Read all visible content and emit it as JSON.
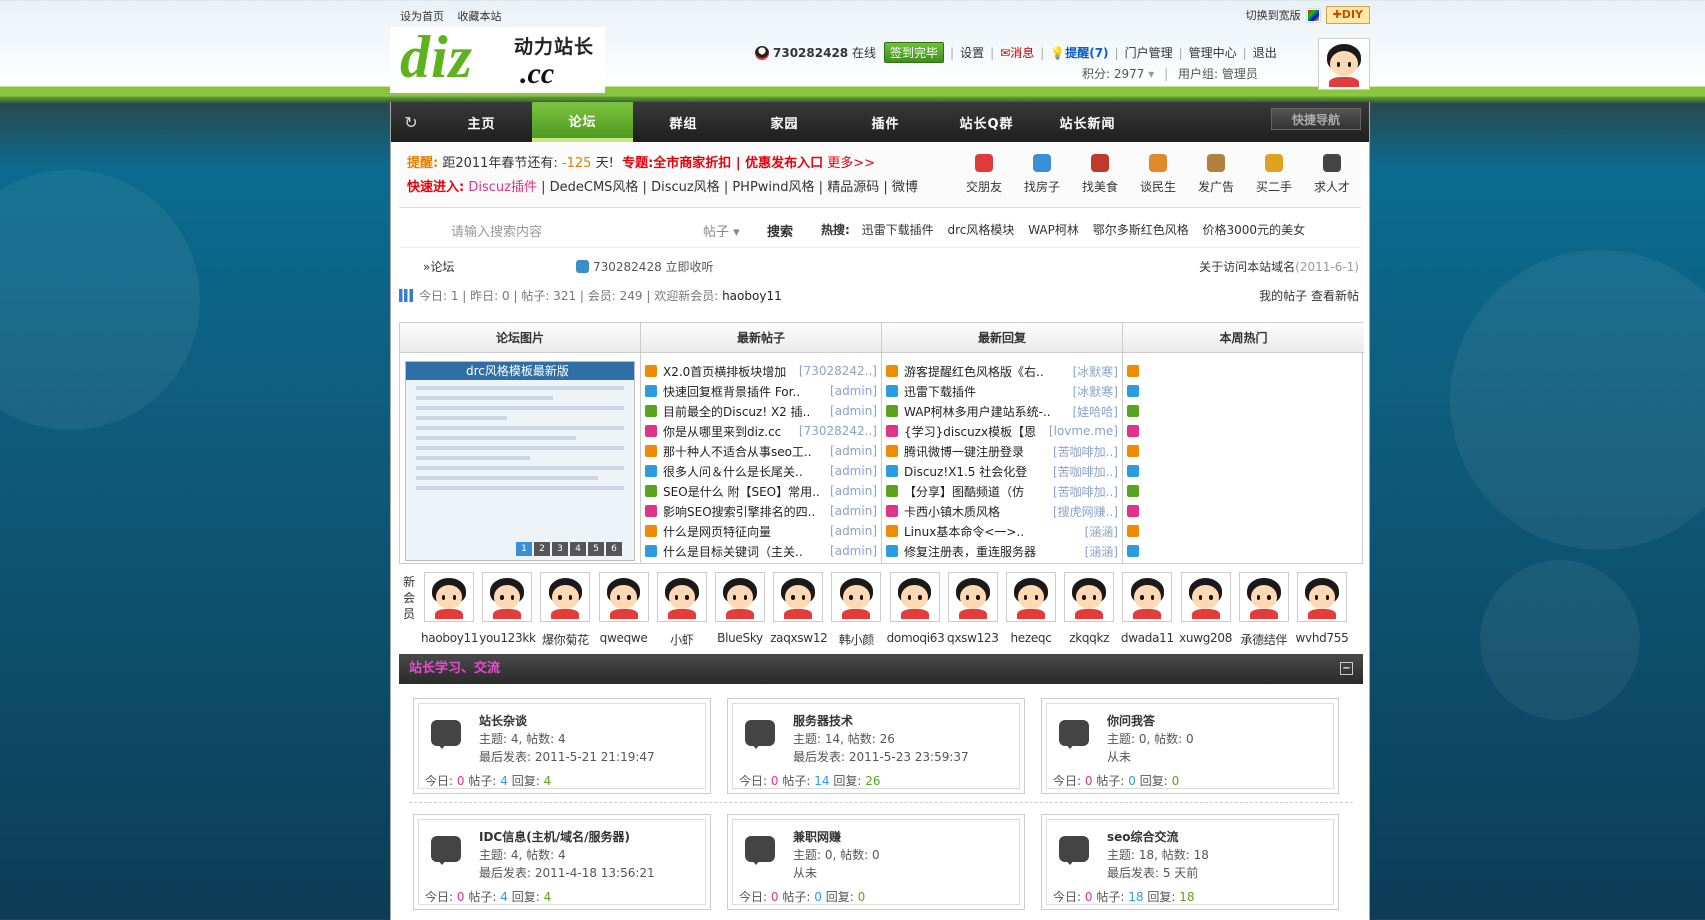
{
  "topbar": {
    "set_home": "设为首页",
    "favorite": "收藏本站",
    "switch_wide": "切换到宽版",
    "diy": "✚DIY"
  },
  "logo": {
    "brand_cn": "动力站长",
    "brand": "diz",
    "tld": ".cc"
  },
  "user": {
    "qq": "730282428",
    "online": "在线",
    "sign": "签到完毕",
    "settings": "设置",
    "messages": "消息",
    "reminders": "提醒(7)",
    "portal_admin": "门户管理",
    "admin_center": "管理中心",
    "logout": "退出",
    "points": "积分: 2977",
    "group": "用户组: 管理员"
  },
  "nav": {
    "items": [
      "主页",
      "论坛",
      "群组",
      "家园",
      "插件",
      "站长Q群",
      "站长新闻"
    ],
    "active": 1,
    "quick": "快捷导航"
  },
  "notice": {
    "label": "提醒:",
    "countdown_pre": "距2011年春节还有:",
    "countdown_val": "-125",
    "countdown_unit": "天!",
    "promo": "专题:全市商家折扣 | 优惠发布入口",
    "more": "更多>>",
    "quick_label": "快速进入:",
    "quick_links": [
      "Discuz插件",
      "DedeCMS风格",
      "Discuz风格",
      "PHPwind风格",
      "精品源码",
      "微博"
    ]
  },
  "categories": [
    {
      "label": "交朋友",
      "color": "#e03a3a"
    },
    {
      "label": "找房子",
      "color": "#3a8fd8"
    },
    {
      "label": "找美食",
      "color": "#c0392b"
    },
    {
      "label": "谈民生",
      "color": "#e08a2a"
    },
    {
      "label": "发广告",
      "color": "#b08040"
    },
    {
      "label": "买二手",
      "color": "#e0a020"
    },
    {
      "label": "求人才",
      "color": "#444444"
    }
  ],
  "search": {
    "placeholder": "请输入搜索内容",
    "select": "帖子 ▾",
    "button": "搜索",
    "hot_label": "热搜:",
    "hot": [
      "迅雷下载插件",
      "drc风格模块",
      "WAP柯林",
      "鄂尔多斯红色风格",
      "价格3000元的美女"
    ]
  },
  "crumb": {
    "home": "»论坛",
    "qq_text": "730282428 立即收听",
    "notice_title": "关于访问本站域名",
    "notice_date": "(2011-6-1)"
  },
  "stats": {
    "text": "今日: 1 | 昨日: 0 | 帖子: 321 | 会员: 249 | 欢迎新会员:",
    "newest": "haoboy11",
    "my_posts": "我的帖子",
    "new_posts": "查看新帖"
  },
  "panels": {
    "pics": "论坛图片",
    "latest": "最新帖子",
    "replies": "最新回复",
    "hot": "本周热门",
    "pic_caption": "drc风格模板最新版"
  },
  "latest_posts": [
    {
      "t": "X2.0首页横排板块增加",
      "u": "[73028242..]"
    },
    {
      "t": "快速回复框背景插件 For..",
      "u": "[admin]"
    },
    {
      "t": "目前最全的Discuz! X2 插..",
      "u": "[admin]"
    },
    {
      "t": "你是从哪里来到diz.cc",
      "u": "[73028242..]"
    },
    {
      "t": "那十种人不适合从事seo工..",
      "u": "[admin]"
    },
    {
      "t": "很多人问＆什么是长尾关..",
      "u": "[admin]"
    },
    {
      "t": "SEO是什么 附【SEO】常用..",
      "u": "[admin]"
    },
    {
      "t": "影响SEO搜索引擎排名的四..",
      "u": "[admin]"
    },
    {
      "t": "什么是网页特征向量",
      "u": "[admin]"
    },
    {
      "t": "什么是目标关键词（主关..",
      "u": "[admin]"
    }
  ],
  "latest_replies": [
    {
      "t": "游客提醒红色风格版《右..",
      "u": "[冰默寒]"
    },
    {
      "t": "迅雷下载插件",
      "u": "[冰默寒]"
    },
    {
      "t": "WAP柯林多用户建站系统-..",
      "u": "[娃哈哈]"
    },
    {
      "t": "{学习}discuzx模板【恩",
      "u": "[lovme.me]"
    },
    {
      "t": "腾讯微博一键注册登录",
      "u": "[苦咖啡加..]"
    },
    {
      "t": "Discuz!X1.5 社会化登",
      "u": "[苦咖啡加..]"
    },
    {
      "t": "【分享】图酷频道（仿",
      "u": "[苦咖啡加..]"
    },
    {
      "t": "卡西小镇木质风格",
      "u": "[搜虎网赚..]"
    },
    {
      "t": "Linux基本命令<一>..",
      "u": "[涵涵]"
    },
    {
      "t": "修复注册表，重连服务器",
      "u": "[涵涵]"
    }
  ],
  "members": {
    "label": "新会员",
    "names": [
      "haoboy11",
      "you123kk",
      "爆你菊花",
      "qweqwe",
      "小虾",
      "BlueSky",
      "zaqxsw12",
      "韩小颜",
      "domoqi63",
      "qxsw123",
      "hezeqc",
      "zkqqkz",
      "dwada11",
      "xuwg208",
      "承德结伴",
      "wvhd755"
    ]
  },
  "section": {
    "title": "站长学习、交流",
    "collapse": "−",
    "forums": [
      {
        "name": "站长杂谈",
        "stats": "主题: 4, 帖数: 4",
        "last": "最后发表: 2011-5-21 21:19:47",
        "today": "0",
        "posts": "4",
        "replies": "4"
      },
      {
        "name": "服务器技术",
        "stats": "主题: 14, 帖数: 26",
        "last": "最后发表: 2011-5-23 23:59:37",
        "today": "0",
        "posts": "14",
        "replies": "26"
      },
      {
        "name": "你问我答",
        "stats": "主题: 0, 帖数: 0",
        "last": "从未",
        "today": "0",
        "posts": "0",
        "replies": "0"
      },
      {
        "name": "IDC信息(主机/域名/服务器)",
        "stats": "主题: 4, 帖数: 4",
        "last": "最后发表: 2011-4-18 13:56:21",
        "today": "0",
        "posts": "4",
        "replies": "4"
      },
      {
        "name": "兼职网赚",
        "stats": "主题: 0, 帖数: 0",
        "last": "从未",
        "today": "0",
        "posts": "0",
        "replies": "0"
      },
      {
        "name": "seo综合交流",
        "stats": "主题: 18, 帖数: 18",
        "last": "最后发表: 5 天前",
        "today": "0",
        "posts": "18",
        "replies": "18"
      }
    ],
    "today_label": "今日:",
    "posts_label": "帖子:",
    "replies_label": "回复:"
  },
  "colors": {
    "accent": "#8cc63f",
    "nav_bg": "#2a2a2a",
    "section_title": "#e64bd1",
    "index_icons": [
      "#f08a00",
      "#2a9de0",
      "#5aa520",
      "#e0338a"
    ]
  }
}
